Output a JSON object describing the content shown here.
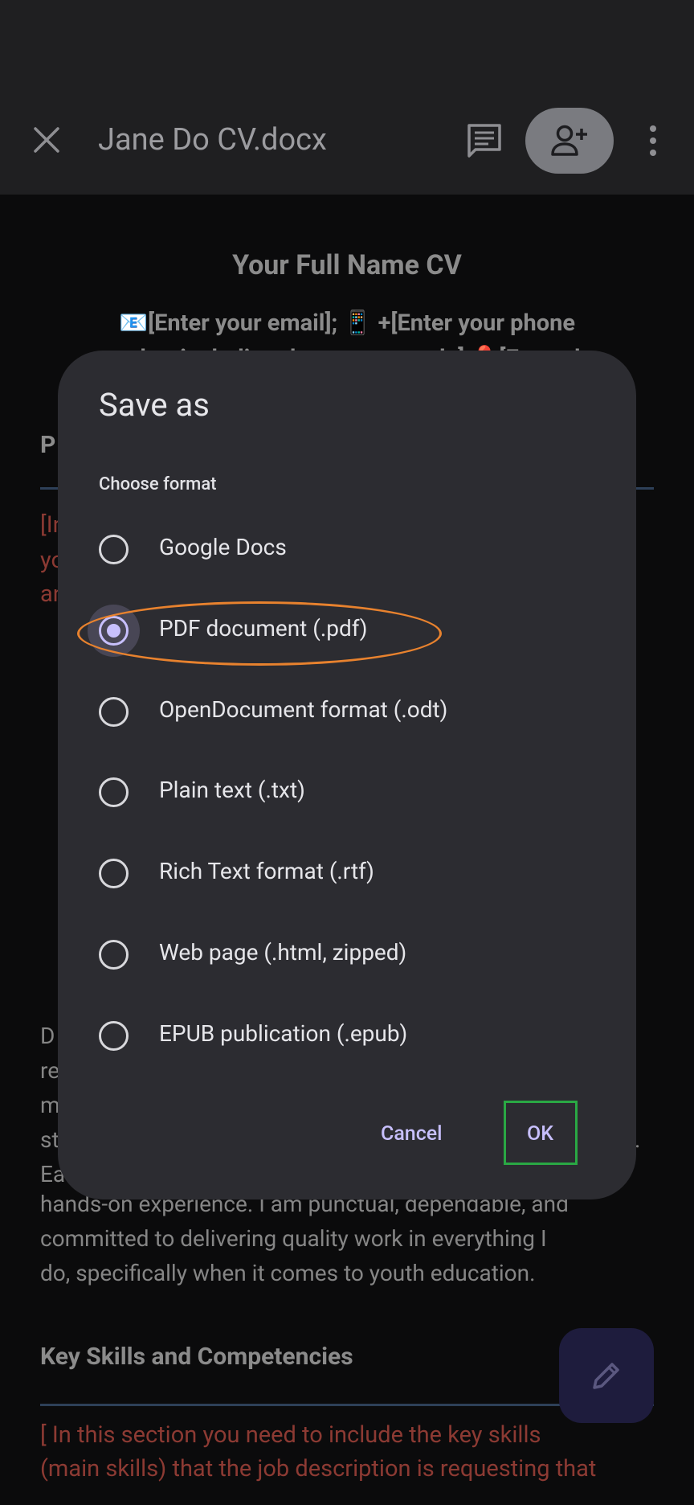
{
  "app_bar": {
    "title": "Jane Do CV.docx",
    "close_icon": "close-icon",
    "comment_icon": "comment-icon",
    "share_icon": "add-person-icon",
    "more_icon": "more-vert-icon"
  },
  "document": {
    "title": "Your Full Name CV",
    "contact_line1": "📧[Enter your email]; 📱 +[Enter your phone",
    "contact_line2": "number including the country code] 📍[Enter the",
    "section_initial": "P",
    "red_frag1": "[In",
    "red_frag2": "yo",
    "red_frag3": "an",
    "frag_d": "D",
    "frag_re": "re",
    "frag_m": "m",
    "frag_st": "st",
    "frag_ea": "Ea",
    "frag_e": "e",
    "frag_dot": ".",
    "para_line1": "hands-on experience. I am punctual, dependable, and",
    "para_line2": "committed to delivering quality work in everything I",
    "para_line3": "do, specifically when it comes to youth education.",
    "skills_heading": "Key Skills and Competencies",
    "skills_red1": "[ In this section you need to include the key skills",
    "skills_red2": "(main skills) that the job description is requesting that",
    "edit_fab_icon": "edit-pencil-icon"
  },
  "dialog": {
    "title": "Save as",
    "subtitle": "Choose format",
    "options": [
      {
        "label": "Google Docs",
        "selected": false
      },
      {
        "label": "PDF document (.pdf)",
        "selected": true
      },
      {
        "label": "OpenDocument format (.odt)",
        "selected": false
      },
      {
        "label": "Plain text (.txt)",
        "selected": false
      },
      {
        "label": "Rich Text format (.rtf)",
        "selected": false
      },
      {
        "label": "Web page (.html, zipped)",
        "selected": false
      },
      {
        "label": "EPUB publication (.epub)",
        "selected": false
      }
    ],
    "cancel_label": "Cancel",
    "ok_label": "OK"
  },
  "colors": {
    "accent": "#c7bffc",
    "highlight_ellipse": "#e8822e",
    "highlight_box": "#2aa844",
    "dialog_bg": "#2c2c31"
  }
}
